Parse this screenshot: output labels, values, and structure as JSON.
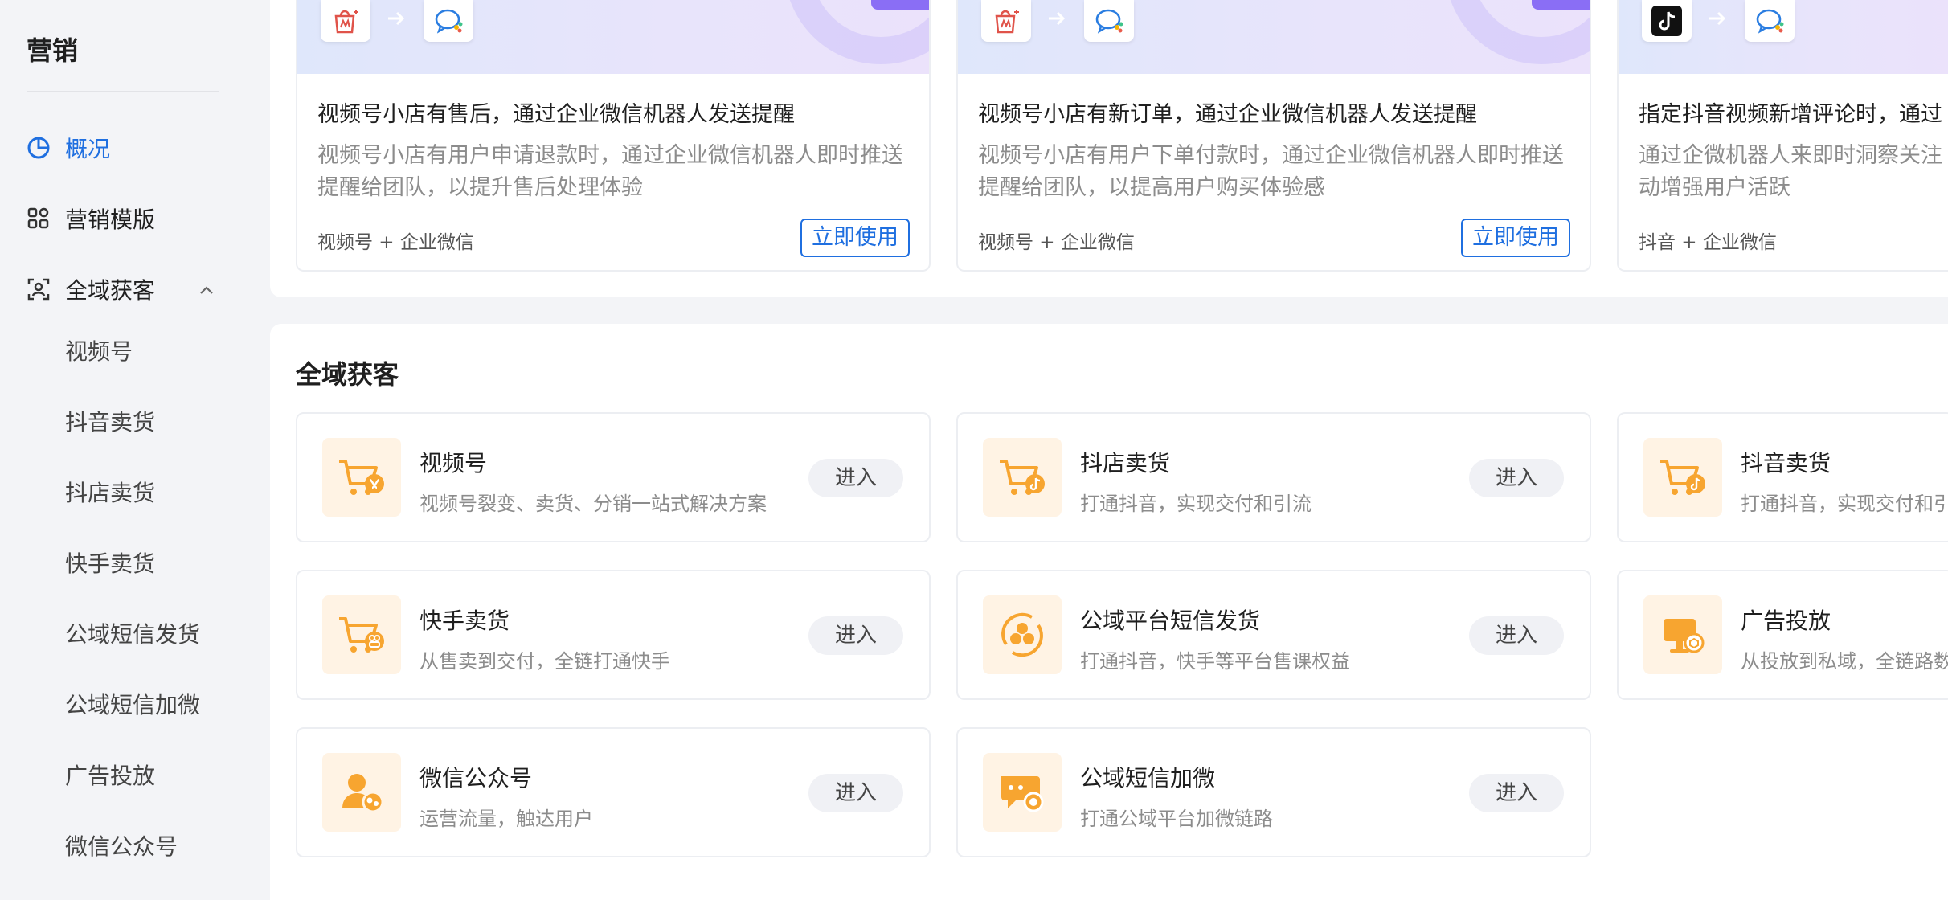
{
  "sidebar": {
    "title": "营销",
    "nav": [
      {
        "label": "概况"
      },
      {
        "label": "营销模版"
      },
      {
        "label": "全域获客"
      }
    ],
    "sub_items": [
      "视频号",
      "抖音卖货",
      "抖店卖货",
      "快手卖货",
      "公域短信发货",
      "公域短信加微",
      "广告投放",
      "微信公众号"
    ]
  },
  "templates": [
    {
      "title": "视频号小店有售后，通过企业微信机器人发送提醒",
      "desc": "视频号小店有用户申请退款时，通过企业微信机器人即时推送提醒给团队，以提升售后处理体验",
      "source": "视频号 + 企业微信",
      "button": "立即使用"
    },
    {
      "title": "视频号小店有新订单，通过企业微信机器人发送提醒",
      "desc": "视频号小店有用户下单付款时，通过企业微信机器人即时推送提醒给团队，以提高用户购买体验感",
      "source": "视频号 + 企业微信",
      "button": "立即使用"
    },
    {
      "title": "指定抖音视频新增评论时，通过",
      "desc": "通过企微机器人来即时洞察关注动增强用户活跃",
      "source": "抖音 + 企业微信",
      "button": ""
    }
  ],
  "section": {
    "title": "全域获客"
  },
  "entries": [
    {
      "name": "视频号",
      "desc": "视频号裂变、卖货、分销一站式解决方案",
      "button": "进入",
      "icon": "cart-channels-icon"
    },
    {
      "name": "抖店卖货",
      "desc": "打通抖音，实现交付和引流",
      "button": "进入",
      "icon": "cart-douyin-icon"
    },
    {
      "name": "抖音卖货",
      "desc": "打通抖音，实现交付和引",
      "button": "",
      "icon": "cart-douyin-icon"
    },
    {
      "name": "快手卖货",
      "desc": "从售卖到交付，全链打通快手",
      "button": "进入",
      "icon": "cart-kuaishou-icon"
    },
    {
      "name": "公域平台短信发货",
      "desc": "打通抖音，快手等平台售课权益",
      "button": "进入",
      "icon": "platform-sms-icon"
    },
    {
      "name": "广告投放",
      "desc": "从投放到私域，全链路数",
      "button": "",
      "icon": "ad-icon"
    },
    {
      "name": "微信公众号",
      "desc": "运营流量，触达用户",
      "button": "进入",
      "icon": "wechat-official-icon"
    },
    {
      "name": "公域短信加微",
      "desc": "打通公域平台加微链路",
      "button": "进入",
      "icon": "sms-chat-icon"
    }
  ],
  "colors": {
    "accent": "#1f6fe0",
    "icon_orange": "#f7a530",
    "icon_bg": "#fff3e4"
  }
}
